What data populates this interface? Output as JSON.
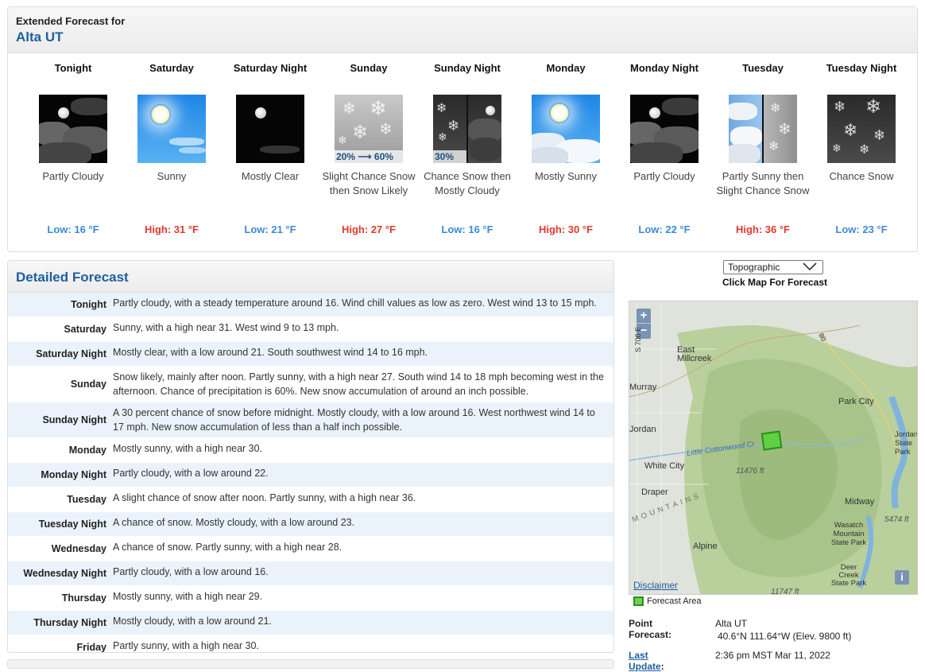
{
  "header": {
    "line1": "Extended Forecast for",
    "location": "Alta UT"
  },
  "periods": [
    {
      "name": "Tonight",
      "desc": "Partly Cloudy",
      "temp": "Low: 16 °F",
      "kind": "low",
      "icon": "night-partly-cloudy-icon"
    },
    {
      "name": "Saturday",
      "desc": "Sunny",
      "temp": "High: 31 °F",
      "kind": "high",
      "icon": "sunny-icon"
    },
    {
      "name": "Saturday Night",
      "desc": "Mostly Clear",
      "temp": "Low: 21 °F",
      "kind": "low",
      "icon": "night-clear-icon"
    },
    {
      "name": "Sunday",
      "desc": "Slight Chance Snow then Snow Likely",
      "temp": "High: 27 °F",
      "kind": "high",
      "icon": "snow-icon",
      "pop_from": "20%",
      "pop_to": "60%"
    },
    {
      "name": "Sunday Night",
      "desc": "Chance Snow then Mostly Cloudy",
      "temp": "Low: 16 °F",
      "kind": "low",
      "icon": "snow-then-cloudy-night-icon",
      "pop": "30%"
    },
    {
      "name": "Monday",
      "desc": "Mostly Sunny",
      "temp": "High: 30 °F",
      "kind": "high",
      "icon": "mostly-sunny-icon"
    },
    {
      "name": "Monday Night",
      "desc": "Partly Cloudy",
      "temp": "Low: 22 °F",
      "kind": "low",
      "icon": "night-partly-cloudy-icon"
    },
    {
      "name": "Tuesday",
      "desc": "Partly Sunny then Slight Chance Snow",
      "temp": "High: 36 °F",
      "kind": "high",
      "icon": "partly-sunny-then-snow-icon"
    },
    {
      "name": "Tuesday Night",
      "desc": "Chance Snow",
      "temp": "Low: 23 °F",
      "kind": "low",
      "icon": "night-snow-icon"
    }
  ],
  "detailed": {
    "title": "Detailed Forecast",
    "rows": [
      {
        "label": "Tonight",
        "text": "Partly cloudy, with a steady temperature around 16. Wind chill values as low as zero. West wind 13 to 15 mph."
      },
      {
        "label": "Saturday",
        "text": "Sunny, with a high near 31. West wind 9 to 13 mph."
      },
      {
        "label": "Saturday Night",
        "text": "Mostly clear, with a low around 21. South southwest wind 14 to 16 mph."
      },
      {
        "label": "Sunday",
        "text": "Snow likely, mainly after noon. Partly sunny, with a high near 27. South wind 14 to 18 mph becoming west in the afternoon. Chance of precipitation is 60%. New snow accumulation of around an inch possible."
      },
      {
        "label": "Sunday Night",
        "text": "A 30 percent chance of snow before midnight. Mostly cloudy, with a low around 16. West northwest wind 14 to 17 mph. New snow accumulation of less than a half inch possible."
      },
      {
        "label": "Monday",
        "text": "Mostly sunny, with a high near 30."
      },
      {
        "label": "Monday Night",
        "text": "Partly cloudy, with a low around 22."
      },
      {
        "label": "Tuesday",
        "text": "A slight chance of snow after noon. Partly sunny, with a high near 36."
      },
      {
        "label": "Tuesday Night",
        "text": "A chance of snow. Mostly cloudy, with a low around 23."
      },
      {
        "label": "Wednesday",
        "text": "A chance of snow. Partly sunny, with a high near 28."
      },
      {
        "label": "Wednesday Night",
        "text": "Partly cloudy, with a low around 16."
      },
      {
        "label": "Thursday",
        "text": "Mostly sunny, with a high near 29."
      },
      {
        "label": "Thursday Night",
        "text": "Mostly cloudy, with a low around 21."
      },
      {
        "label": "Friday",
        "text": "Partly sunny, with a high near 30."
      }
    ]
  },
  "map": {
    "select_value": "Topographic",
    "click_label": "Click Map For Forecast",
    "zoom_in": "+",
    "zoom_out": "−",
    "places": [
      "East Millcreek",
      "Murray",
      "Park City",
      "Jordan",
      "White City",
      "Draper",
      "Midway",
      "Alpine",
      "Wasatch Mountain State Park",
      "Deer Creek State Park",
      "Jordanelle State Park"
    ],
    "elevations": [
      "11476 ft",
      "5474 ft",
      "11747 ft"
    ],
    "road_labels": [
      "S 700 E",
      "80"
    ],
    "feature_labels": [
      "Little Cottonwood Cr",
      "MOUNTAINS"
    ],
    "disclaimer": "Disclaimer",
    "info": "i",
    "legend": "Forecast Area"
  },
  "point_forecast": {
    "label": "Point Forecast:",
    "place": "Alta UT",
    "coords": "40.6°N 111.64°W (Elev. 9800 ft)",
    "update_label": "Last Update",
    "update_colon": ":",
    "update_value": "2:36 pm MST Mar 11, 2022"
  },
  "colors": {
    "accent": "#1f5fa0",
    "low": "#3d8ad6",
    "high": "#e03a2e",
    "forecast_area": "#5fd042"
  }
}
